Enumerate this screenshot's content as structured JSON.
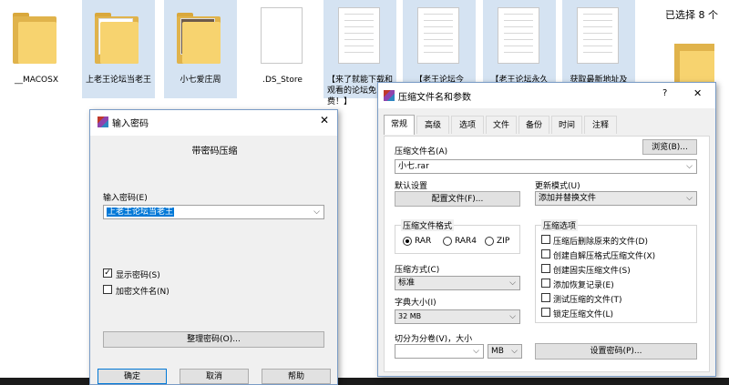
{
  "explorer": {
    "tiles": [
      {
        "label": "__MACOSX"
      },
      {
        "label": "上老王论坛当老王"
      },
      {
        "label": "小七爱庄周"
      },
      {
        "label": ".DS_Store"
      },
      {
        "label": "【来了就能下载和观看的论坛免费！】"
      },
      {
        "label": "【老王论坛今"
      },
      {
        "label": "【老王论坛永久"
      },
      {
        "label": "获取最新地址及"
      }
    ],
    "selected_text": "已选择 8 个"
  },
  "password_dialog": {
    "title": "输入密码",
    "heading": "带密码压缩",
    "password_label": "输入密码(E)",
    "password_value": "上老王论坛当老王",
    "show_password": "显示密码(S)",
    "encrypt_names": "加密文件名(N)",
    "organize_button": "整理密码(O)...",
    "ok": "确定",
    "cancel": "取消",
    "help": "帮助"
  },
  "archive_dialog": {
    "title": "压缩文件名和参数",
    "help_glyph": "?",
    "close_glyph": "✕",
    "tabs": [
      "常规",
      "高级",
      "选项",
      "文件",
      "备份",
      "时间",
      "注释"
    ],
    "archive_name_label": "压缩文件名(A)",
    "browse_button": "浏览(B)...",
    "archive_name_value": "小七.rar",
    "default_settings_label": "默认设置",
    "profiles_button": "配置文件(F)...",
    "update_mode_label": "更新模式(U)",
    "update_mode_value": "添加并替换文件",
    "format_group": "压缩文件格式",
    "formats": [
      "RAR",
      "RAR4",
      "ZIP"
    ],
    "method_label": "压缩方式(C)",
    "method_value": "标准",
    "dict_label": "字典大小(I)",
    "dict_value": "32 MB",
    "split_label": "切分为分卷(V)，大小",
    "split_unit": "MB",
    "options_group": "压缩选项",
    "options": [
      "压缩后删除原来的文件(D)",
      "创建自解压格式压缩文件(X)",
      "创建固实压缩文件(S)",
      "添加恢复记录(E)",
      "测试压缩的文件(T)",
      "锁定压缩文件(L)"
    ],
    "set_password_button": "设置密码(P)..."
  },
  "colors": {
    "selection": "#0078d7",
    "tile_selected": "#d5e3f2",
    "dialog_border": "#7a9cc6",
    "folder": "#f7d36f"
  },
  "icons": [
    "folder-icon",
    "document-icon",
    "winrar-icon",
    "close-icon",
    "chevron-down-icon",
    "check-icon"
  ]
}
